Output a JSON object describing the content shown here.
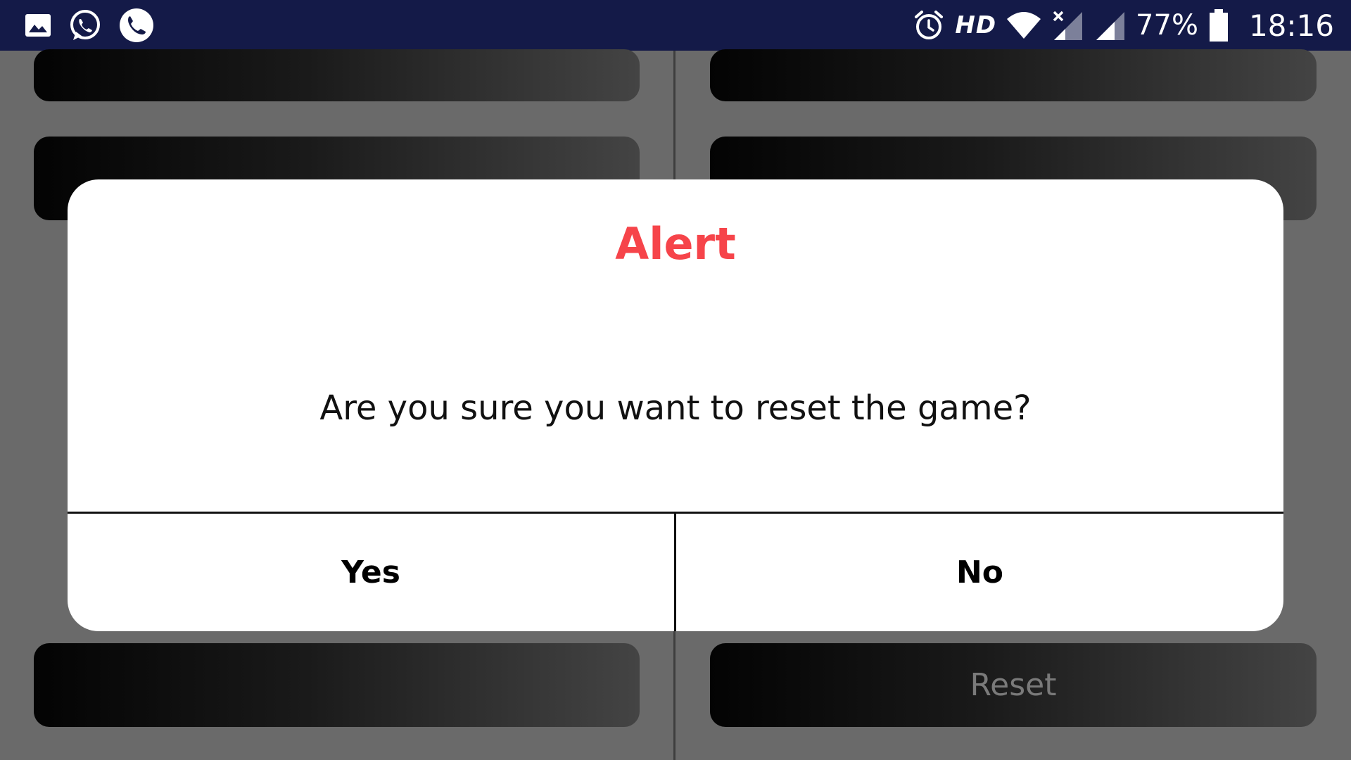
{
  "status_bar": {
    "left_icons": [
      "gallery-icon",
      "whatsapp-icon",
      "phone-call-icon"
    ],
    "right_icons": [
      "alarm-icon",
      "wifi-icon",
      "signal-no-service-icon",
      "signal-icon",
      "battery-icon"
    ],
    "hd_label": "HD",
    "battery_percent": "77%",
    "time": "18:16",
    "background_color": "#141a48"
  },
  "game_board": {
    "reset_label": "Reset",
    "tile_count": 8
  },
  "dialog": {
    "title": "Alert",
    "title_color": "#f6444a",
    "message": "Are you sure you want to reset the game?",
    "buttons": {
      "yes_label": "Yes",
      "no_label": "No"
    }
  }
}
